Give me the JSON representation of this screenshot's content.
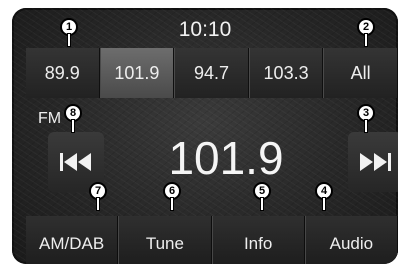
{
  "header": {
    "clock": "10:10"
  },
  "presets": [
    {
      "label": "89.9",
      "active": false
    },
    {
      "label": "101.9",
      "active": true
    },
    {
      "label": "94.7",
      "active": false
    },
    {
      "label": "103.3",
      "active": false
    },
    {
      "label": "All",
      "active": false
    }
  ],
  "tuner": {
    "band": "FM",
    "frequency": "101.9",
    "seek_back_icon": "seek-back-icon",
    "seek_forward_icon": "seek-forward-icon"
  },
  "bottom_bar": [
    {
      "label": "AM/DAB"
    },
    {
      "label": "Tune"
    },
    {
      "label": "Info"
    },
    {
      "label": "Audio"
    }
  ],
  "callouts": [
    "1",
    "2",
    "3",
    "4",
    "5",
    "6",
    "7",
    "8"
  ],
  "colors": {
    "active_preset": "#5a5a5a",
    "text": "#eeeeee",
    "background": "#2a2a2a"
  }
}
